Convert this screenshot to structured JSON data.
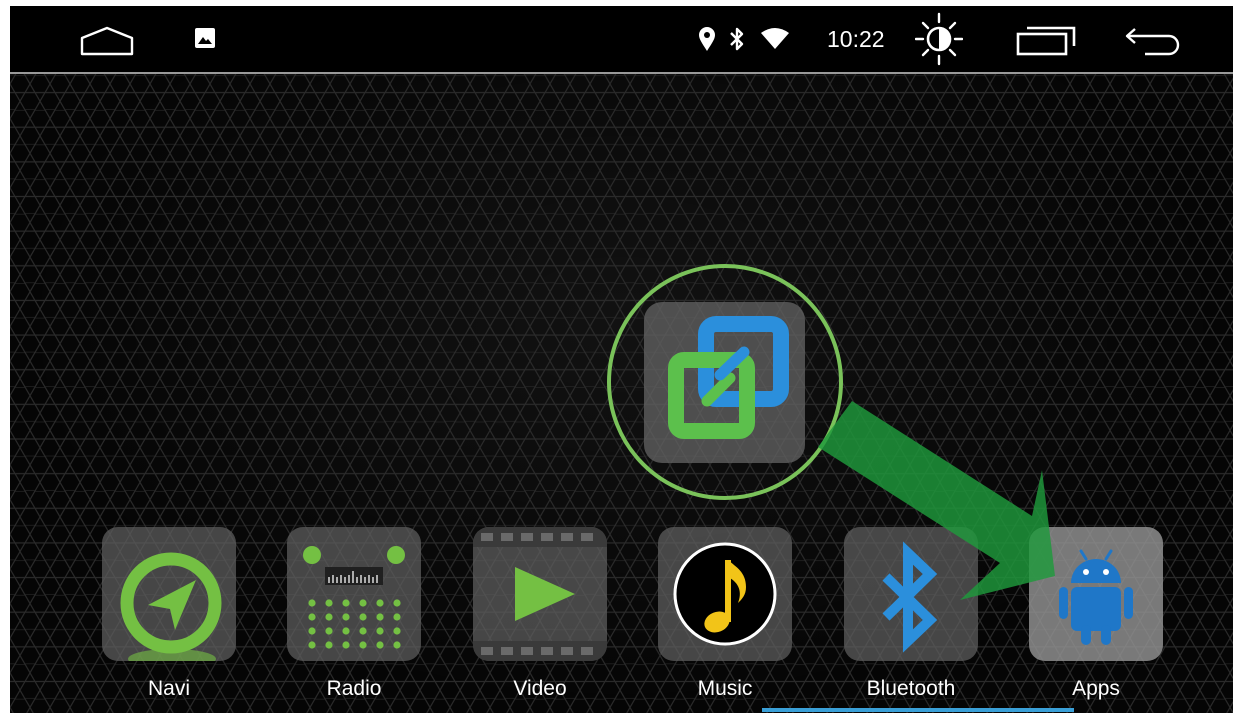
{
  "status_bar": {
    "time": "10:22",
    "icons": [
      "home-icon",
      "gallery-icon",
      "location-icon",
      "bluetooth-icon",
      "wifi-icon",
      "brightness-icon",
      "recent-apps-icon",
      "back-icon"
    ]
  },
  "center_app": {
    "icon": "screen-mirror-icon"
  },
  "dock": {
    "items": [
      {
        "label": "Navi",
        "icon": "navigation-icon"
      },
      {
        "label": "Radio",
        "icon": "radio-icon"
      },
      {
        "label": "Video",
        "icon": "video-icon"
      },
      {
        "label": "Music",
        "icon": "music-icon"
      },
      {
        "label": "Bluetooth",
        "icon": "bluetooth-icon"
      },
      {
        "label": "Apps",
        "icon": "android-icon"
      }
    ],
    "selected": "Apps"
  },
  "colors": {
    "accent_green": "#74c043",
    "arrow_green": "#1f9a3c",
    "android_blue": "#1f77c8",
    "focus_line": "#3aa0d8"
  }
}
